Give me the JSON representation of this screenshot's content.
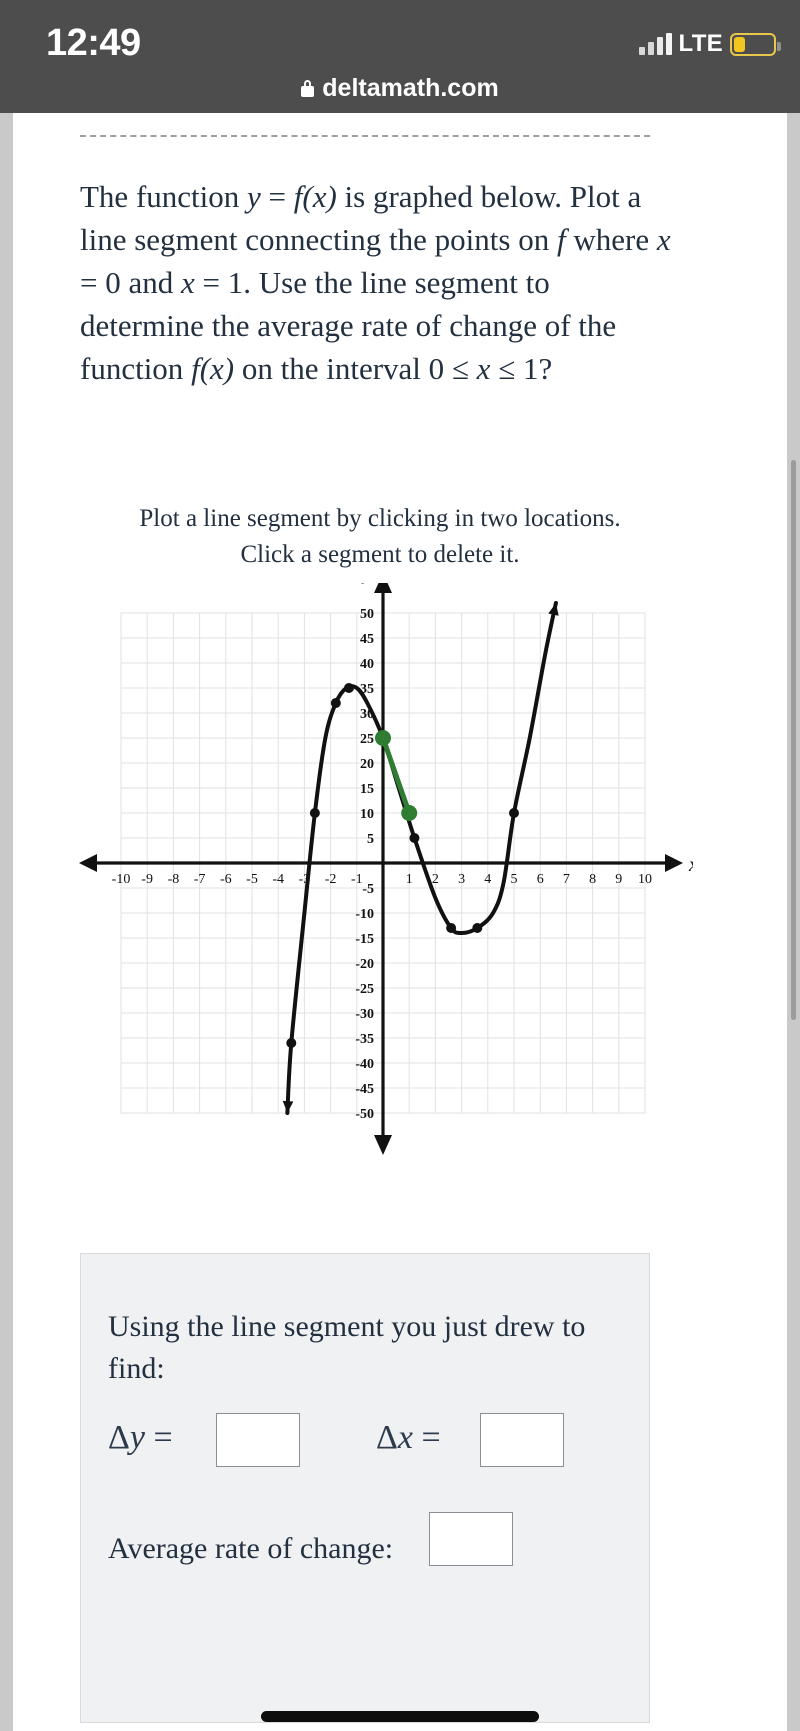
{
  "status_bar": {
    "time": "12:49",
    "network": "LTE",
    "signal_icon": "signal-bars-icon",
    "battery_icon": "battery-low-icon"
  },
  "browser": {
    "lock_icon": "lock-icon",
    "url": "deltamath.com"
  },
  "question": {
    "line1_a": "The function ",
    "line1_y": "y",
    "line1_eq": " = ",
    "line1_f": "f",
    "line1_fx": "(x)",
    "line1_b": " is graphed below. Plot a line segment connecting the points on ",
    "line1_f2": "f",
    "line1_c": " where ",
    "line1_x1": "x",
    "line1_eq2": " = ",
    "line1_0": "0",
    "line1_d": " and ",
    "line1_x2": "x",
    "line1_eq3": " = ",
    "line1_1": "1",
    "line1_e": ". Use the line segment to determine the average rate of change of the function ",
    "line1_f3": "f",
    "line1_fx2": "(x)",
    "line1_g": " on the interval ",
    "line1_int0": "0",
    "line1_le1": " ≤ ",
    "line1_xi": "x",
    "line1_le2": " ≤ ",
    "line1_int1": "1",
    "line1_q": "?"
  },
  "plot_instructions": {
    "line1": "Plot a line segment by clicking in two locations.",
    "line2": "Click a segment to delete it."
  },
  "answer_panel": {
    "prompt": "Using the line segment you just drew to find:",
    "delta_y_label": "Δy =",
    "delta_y_value": "",
    "delta_x_label": "Δx =",
    "delta_x_value": "",
    "average_rate_label": "Average rate of change:",
    "average_rate_value": ""
  },
  "chart_data": {
    "type": "line",
    "title": "",
    "xlabel": "x",
    "ylabel": "y",
    "xlim": [
      -10,
      10
    ],
    "ylim": [
      -50,
      50
    ],
    "grid": true,
    "x_ticks": [
      -10,
      -9,
      -8,
      -7,
      -6,
      -5,
      -4,
      -3,
      -2,
      -1,
      1,
      2,
      3,
      4,
      5,
      6,
      7,
      8,
      9,
      10
    ],
    "x_tick_labels": [
      "-10",
      "-9",
      "-8",
      "-7",
      "-6",
      "-5",
      "-4",
      "-3",
      "-2",
      "-1",
      "1",
      "2",
      "3",
      "4",
      "5",
      "6",
      "7",
      "8",
      "9",
      "10"
    ],
    "y_ticks": [
      50,
      45,
      40,
      35,
      30,
      25,
      20,
      15,
      10,
      5,
      -5,
      -10,
      -15,
      -20,
      -25,
      -30,
      -35,
      -40,
      -45,
      -50
    ],
    "y_tick_labels": [
      "50",
      "45",
      "40",
      "35",
      "30",
      "25",
      "20",
      "15",
      "10",
      "5",
      "-5",
      "-10",
      "-15",
      "-20",
      "-25",
      "-30",
      "-35",
      "-40",
      "-45",
      "-50"
    ],
    "series": [
      {
        "name": "f(x)",
        "color": "#111111",
        "points": [
          {
            "x": -3.65,
            "y": -50
          },
          {
            "x": -3.5,
            "y": -36
          },
          {
            "x": -3.0,
            "y": -10
          },
          {
            "x": -2.6,
            "y": 10
          },
          {
            "x": -2.2,
            "y": 25
          },
          {
            "x": -1.8,
            "y": 32
          },
          {
            "x": -1.4,
            "y": 35
          },
          {
            "x": -1.0,
            "y": 35
          },
          {
            "x": -0.6,
            "y": 32
          },
          {
            "x": 0.0,
            "y": 25
          },
          {
            "x": 0.6,
            "y": 15
          },
          {
            "x": 1.2,
            "y": 5
          },
          {
            "x": 2.0,
            "y": -7
          },
          {
            "x": 2.6,
            "y": -13
          },
          {
            "x": 3.0,
            "y": -14
          },
          {
            "x": 3.6,
            "y": -13
          },
          {
            "x": 4.2,
            "y": -10
          },
          {
            "x": 4.6,
            "y": -4
          },
          {
            "x": 5.0,
            "y": 10
          },
          {
            "x": 5.6,
            "y": 25
          },
          {
            "x": 6.2,
            "y": 42
          },
          {
            "x": 6.6,
            "y": 52
          }
        ]
      }
    ],
    "marked_points": [
      {
        "x": -3.5,
        "y": -36,
        "color": "#111111"
      },
      {
        "x": -2.6,
        "y": 10,
        "color": "#111111"
      },
      {
        "x": -1.8,
        "y": 32,
        "color": "#111111"
      },
      {
        "x": -1.3,
        "y": 35,
        "color": "#111111"
      },
      {
        "x": 1.2,
        "y": 5,
        "color": "#111111"
      },
      {
        "x": 2.6,
        "y": -13,
        "color": "#111111"
      },
      {
        "x": 3.6,
        "y": -13,
        "color": "#111111"
      },
      {
        "x": 5.0,
        "y": 10,
        "color": "#111111"
      }
    ],
    "segment": {
      "name": "user-drawn-segment",
      "color": "#2e7d32",
      "from": {
        "x": 0,
        "y": 25
      },
      "to": {
        "x": 1,
        "y": 10
      }
    }
  },
  "colors": {
    "status_bar_bg": "#4d4d4d",
    "page_bg": "#ffffff",
    "text": "#22303f",
    "segment_green": "#2e7d32",
    "battery_yellow": "#f2c521",
    "panel_bg": "#f0f1f3"
  }
}
